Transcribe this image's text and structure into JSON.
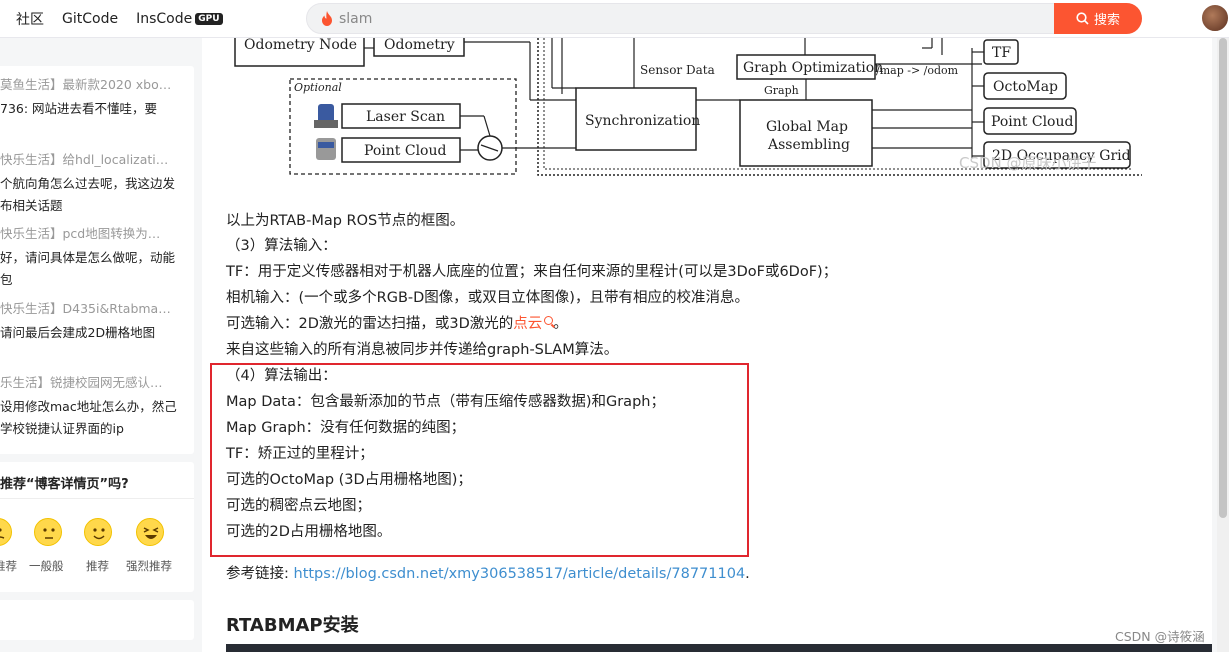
{
  "header": {
    "nav": [
      "社区",
      "GitCode",
      "InsCode"
    ],
    "gpu_badge": "GPU",
    "search_value": "slam",
    "search_button": "搜索"
  },
  "sidebar": {
    "comments": [
      {
        "title": "莫鱼生活】最新款2020 xbo…",
        "body": "736: 网站进去看不懂哇，要"
      },
      {
        "title": "快乐生活】给hdl_localizati…",
        "body": "个航向角怎么过去呢，我这边发布相关话题"
      },
      {
        "title": "快乐生活】pcd地图转换为…",
        "body": "好，请问具体是怎么做呢，动能包"
      },
      {
        "title": "快乐生活】D435i&Rtabma…",
        "body": "请问最后会建成2D栅格地图"
      },
      {
        "title": "乐生活】锐捷校园网无感认…",
        "body": "设用修改mac地址怎么办，然己学校锐捷认证界面的ip"
      }
    ],
    "recommend_question": "推荐“博客详情页”吗?",
    "ratings": [
      "推荐",
      "一般般",
      "推荐",
      "强烈推荐"
    ]
  },
  "diagram": {
    "labels": [
      "Odometry Node",
      "Odometry",
      "Optional",
      "Laser Scan",
      "Point Cloud",
      "Sensor Data",
      "Synchronization",
      "Graph Optimization",
      "/map -> /odom",
      "Graph",
      "Global Map",
      "Assembling",
      "TF",
      "OctoMap",
      "Point Cloud",
      "2D Occupancy Grid"
    ],
    "watermark": "CSDN @原味小饼干"
  },
  "article": {
    "line1": "以上为RTAB-Map ROS节点的框图。",
    "line2": "（3）算法输入：",
    "line3": "TF：用于定义传感器相对于机器人底座的位置；来自任何来源的里程计(可以是3DoF或6DoF)；",
    "line4": "相机输入：(一个或多个RGB-D图像，或双目立体图像)，且带有相应的校准消息。",
    "line5_prefix": "可选输入：2D激光的雷达扫描，或3D激光的",
    "line5_link": "点云",
    "line5_suffix": "。",
    "line6": "来自这些输入的所有消息被同步并传递给graph-SLAM算法。",
    "line7": "（4）算法输出：",
    "line8": "Map Data：包含最新添加的节点（带有压缩传感器数据)和Graph；",
    "line9": "Map Graph：没有任何数据的纯图；",
    "line10": "TF：矫正过的里程计；",
    "line11": "可选的OctoMap (3D占用栅格地图)；",
    "line12": "可选的稠密点云地图；",
    "line13": "可选的2D占用栅格地图。",
    "ref_label": "参考链接: ",
    "ref_url": "https://blog.csdn.net/xmy306538517/article/details/78771104",
    "ref_end": ".",
    "section_heading": "RTABMAP安装",
    "footer_watermark": "CSDN @诗筱涵"
  },
  "colors": {
    "accent": "#fc5531",
    "highlight": "#e0262e",
    "link": "#3e8ecf"
  }
}
